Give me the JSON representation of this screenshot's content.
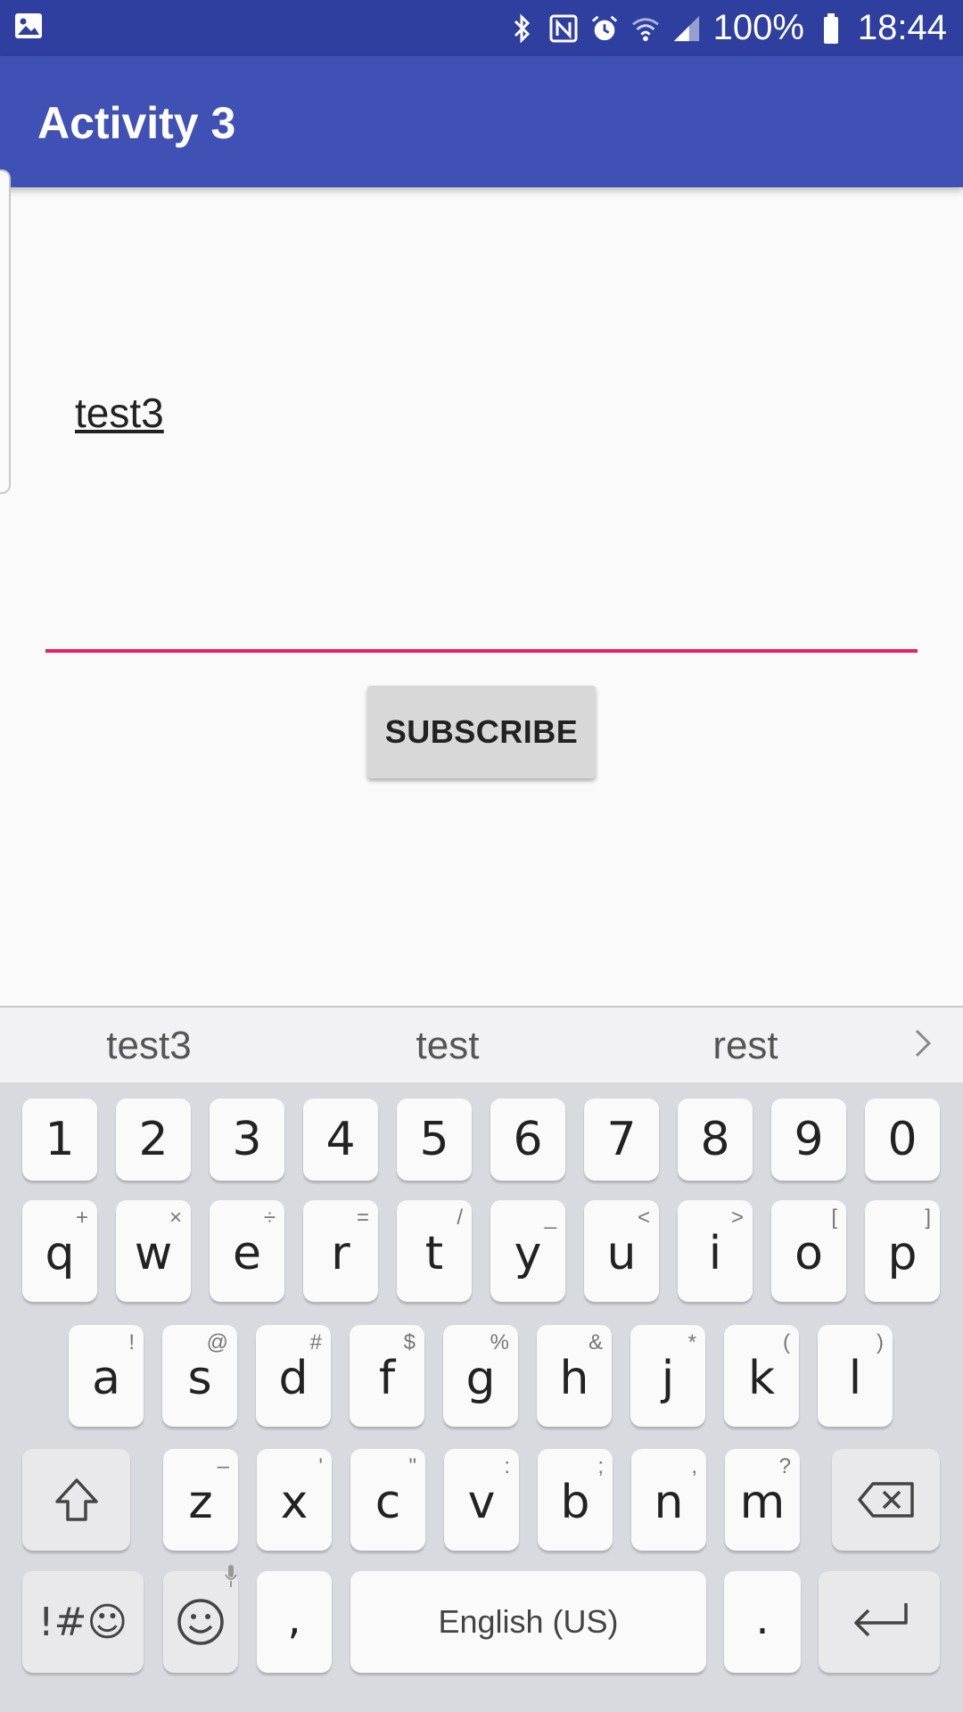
{
  "status_bar": {
    "battery": "100%",
    "time": "18:44",
    "icons": [
      "image-icon",
      "bluetooth-icon",
      "nfc-icon",
      "alarm-icon",
      "wifi-icon",
      "signal-icon",
      "battery-icon"
    ]
  },
  "app_bar": {
    "title": "Activity 3"
  },
  "content": {
    "received_text": "test3",
    "subscribe_label": "SUBSCRIBE",
    "input_accent": "#e91e63"
  },
  "keyboard": {
    "suggestions": [
      "test3",
      "test",
      "rest"
    ],
    "row_numbers": [
      "1",
      "2",
      "3",
      "4",
      "5",
      "6",
      "7",
      "8",
      "9",
      "0"
    ],
    "row_q": [
      {
        "key": "q",
        "sec": "+"
      },
      {
        "key": "w",
        "sec": "×"
      },
      {
        "key": "e",
        "sec": "÷"
      },
      {
        "key": "r",
        "sec": "="
      },
      {
        "key": "t",
        "sec": "/"
      },
      {
        "key": "y",
        "sec": "_"
      },
      {
        "key": "u",
        "sec": "<"
      },
      {
        "key": "i",
        "sec": ">"
      },
      {
        "key": "o",
        "sec": "["
      },
      {
        "key": "p",
        "sec": "]"
      }
    ],
    "row_a": [
      {
        "key": "a",
        "sec": "!"
      },
      {
        "key": "s",
        "sec": "@"
      },
      {
        "key": "d",
        "sec": "#"
      },
      {
        "key": "f",
        "sec": "$"
      },
      {
        "key": "g",
        "sec": "%"
      },
      {
        "key": "h",
        "sec": "&"
      },
      {
        "key": "j",
        "sec": "*"
      },
      {
        "key": "k",
        "sec": "("
      },
      {
        "key": "l",
        "sec": ")"
      }
    ],
    "row_z": [
      {
        "key": "z",
        "sec": "–"
      },
      {
        "key": "x",
        "sec": "'"
      },
      {
        "key": "c",
        "sec": "\""
      },
      {
        "key": "v",
        "sec": ":"
      },
      {
        "key": "b",
        "sec": ";"
      },
      {
        "key": "n",
        "sec": ","
      },
      {
        "key": "m",
        "sec": "?"
      }
    ],
    "symbols_label": "!#☺",
    "comma": ",",
    "space_label": "English (US)",
    "period": "."
  },
  "colors": {
    "status_bar": "#2f3f9f",
    "app_bar": "#3f51b5",
    "background": "#fafafa",
    "button": "#d8d8d8"
  }
}
